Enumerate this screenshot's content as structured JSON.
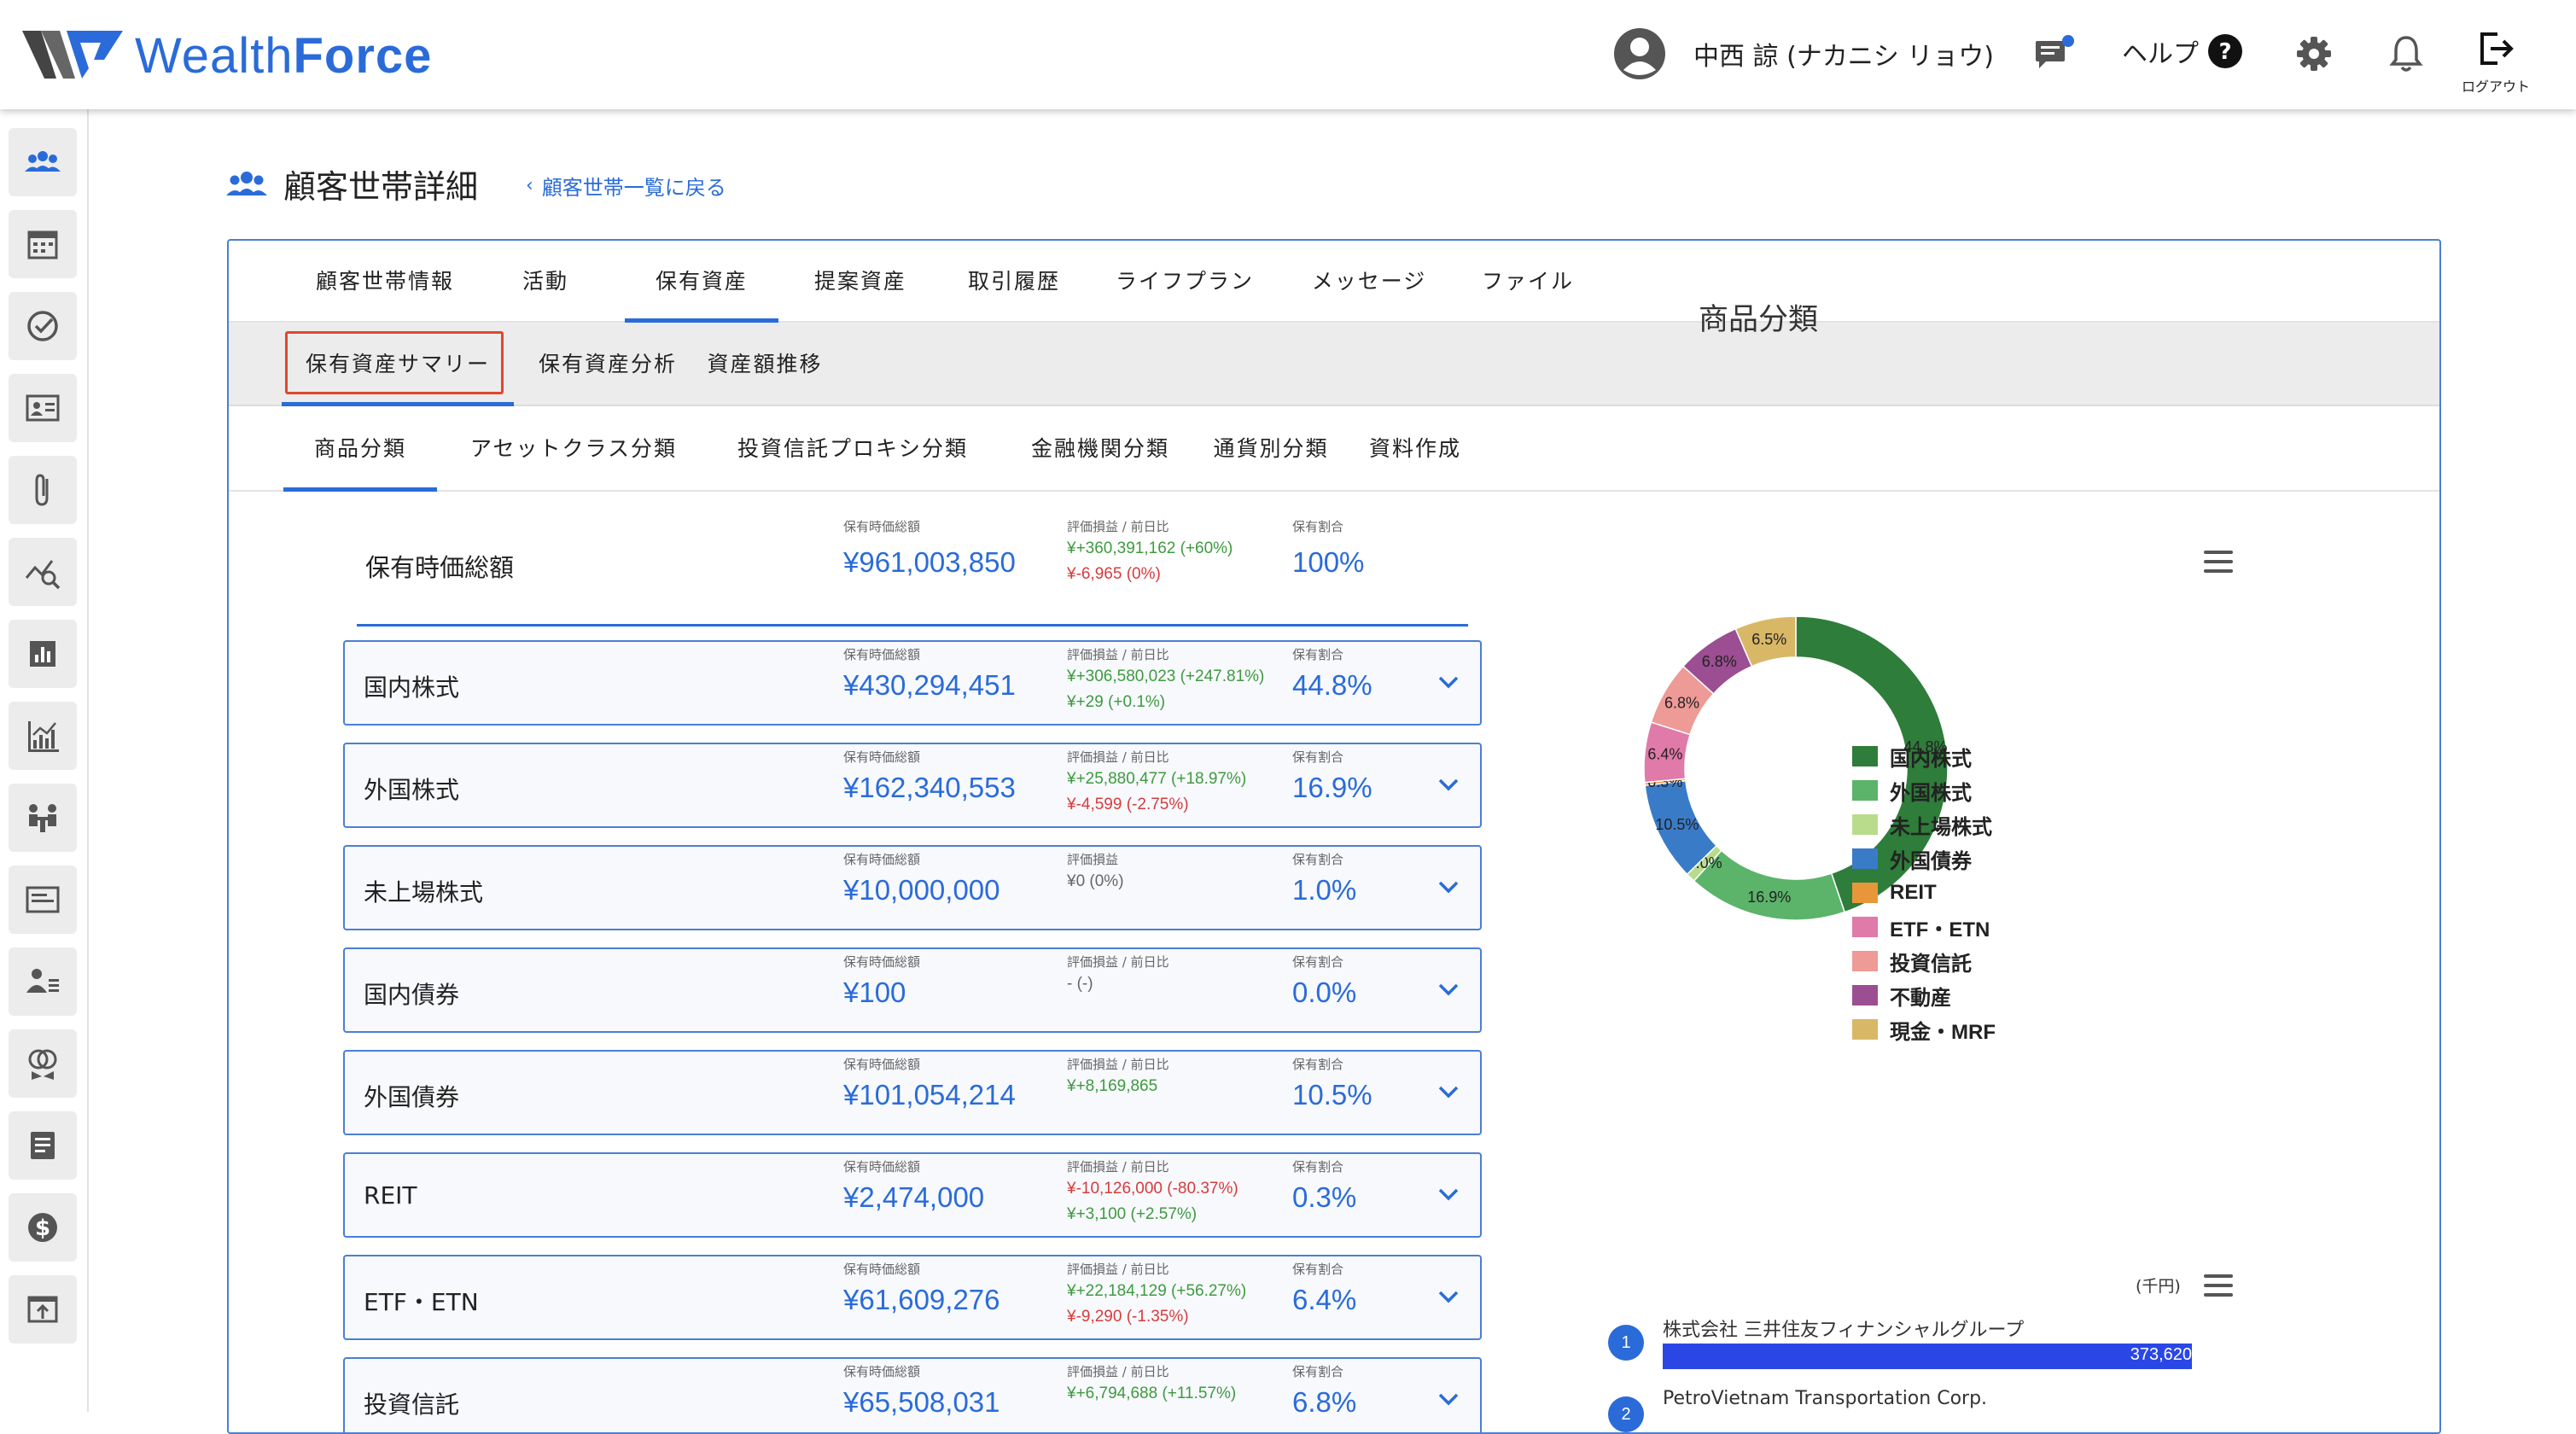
{
  "header": {
    "logo_text": "WealthForce",
    "user_name": "中西 諒 (ナカニシ リョウ)",
    "help_label": "ヘルプ",
    "logout_label": "ログアウト",
    "icons": [
      "avatar-icon",
      "chat-icon",
      "help-icon",
      "gear-icon",
      "bell-icon",
      "logout-icon"
    ],
    "accent_color": "#2a6bd9"
  },
  "sidebar": {
    "items": [
      "household-icon",
      "calendar-icon",
      "check-circle-icon",
      "profile-card-icon",
      "paperclip-icon",
      "chart-search-icon",
      "bar-chart-icon",
      "growth-chart-icon",
      "meeting-icon",
      "window-icon",
      "user-list-icon",
      "rings-icon",
      "document-icon",
      "dollar-icon",
      "export-icon"
    ]
  },
  "page": {
    "title": "顧客世帯詳細",
    "back_link": "顧客世帯一覧に戻る"
  },
  "tabs_main": [
    "顧客世帯情報",
    "活動",
    "保有資産",
    "提案資産",
    "取引履歴",
    "ライフプラン",
    "メッセージ",
    "ファイル"
  ],
  "tabs_main_active": "保有資産",
  "tabs_sub": [
    "保有資産サマリー",
    "保有資産分析",
    "資産額推移"
  ],
  "tabs_sub_active": "保有資産サマリー",
  "tabs_third": [
    "商品分類",
    "アセットクラス分類",
    "投資信託プロキシ分類",
    "金融機関分類",
    "通貨別分類",
    "資料作成"
  ],
  "tabs_third_active": "商品分類",
  "summary": {
    "title": "保有時価総額",
    "value_label": "保有時価総額",
    "value": "¥961,003,850",
    "pl_label": "評価損益 / 前日比",
    "pl_1": "¥+360,391,162 (+60%)",
    "pl_2": "¥-6,965 (0%)",
    "ratio_label": "保有割合",
    "ratio": "100%"
  },
  "rows": [
    {
      "name": "国内株式",
      "value_label": "保有時価総額",
      "value": "¥430,294,451",
      "pl_label": "評価損益 / 前日比",
      "pl_1": "¥+306,580,023 (+247.81%)",
      "pl_1_color": "green",
      "pl_2": "¥+29 (+0.1%)",
      "pl_2_color": "green",
      "ratio_label": "保有割合",
      "ratio": "44.8%"
    },
    {
      "name": "外国株式",
      "value_label": "保有時価総額",
      "value": "¥162,340,553",
      "pl_label": "評価損益 / 前日比",
      "pl_1": "¥+25,880,477 (+18.97%)",
      "pl_1_color": "green",
      "pl_2": "¥-4,599 (-2.75%)",
      "pl_2_color": "red",
      "ratio_label": "保有割合",
      "ratio": "16.9%"
    },
    {
      "name": "未上場株式",
      "value_label": "保有時価総額",
      "value": "¥10,000,000",
      "pl_label": "評価損益",
      "pl_1": "¥0 (0%)",
      "pl_1_color": "gray",
      "pl_2": "",
      "pl_2_color": "gray",
      "ratio_label": "保有割合",
      "ratio": "1.0%"
    },
    {
      "name": "国内債券",
      "value_label": "保有時価総額",
      "value": "¥100",
      "pl_label": "評価損益 / 前日比",
      "pl_1": "- (-)",
      "pl_1_color": "gray",
      "pl_2": "",
      "pl_2_color": "gray",
      "ratio_label": "保有割合",
      "ratio": "0.0%"
    },
    {
      "name": "外国債券",
      "value_label": "保有時価総額",
      "value": "¥101,054,214",
      "pl_label": "評価損益 / 前日比",
      "pl_1": "¥+8,169,865",
      "pl_1_color": "green",
      "pl_2": "",
      "pl_2_color": "gray",
      "ratio_label": "保有割合",
      "ratio": "10.5%"
    },
    {
      "name": "REIT",
      "value_label": "保有時価総額",
      "value": "¥2,474,000",
      "pl_label": "評価損益 / 前日比",
      "pl_1": "¥-10,126,000 (-80.37%)",
      "pl_1_color": "red",
      "pl_2": "¥+3,100 (+2.57%)",
      "pl_2_color": "green",
      "ratio_label": "保有割合",
      "ratio": "0.3%"
    },
    {
      "name": "ETF・ETN",
      "value_label": "保有時価総額",
      "value": "¥61,609,276",
      "pl_label": "評価損益 / 前日比",
      "pl_1": "¥+22,184,129 (+56.27%)",
      "pl_1_color": "green",
      "pl_2": "¥-9,290 (-1.35%)",
      "pl_2_color": "red",
      "ratio_label": "保有割合",
      "ratio": "6.4%"
    },
    {
      "name": "投資信託",
      "value_label": "保有時価総額",
      "value": "¥65,508,031",
      "pl_label": "評価損益 / 前日比",
      "pl_1": "¥+6,794,688 (+11.57%)",
      "pl_1_color": "green",
      "pl_2": "",
      "pl_2_color": "gray",
      "ratio_label": "保有割合",
      "ratio": "6.8%"
    }
  ],
  "chart_data": [
    {
      "type": "pie",
      "title": "商品分類",
      "categories": [
        "国内株式",
        "外国株式",
        "未上場株式",
        "外国債券",
        "REIT",
        "ETF・ETN",
        "投資信託",
        "不動産",
        "現金・MRF"
      ],
      "values": [
        44.8,
        16.9,
        1.0,
        10.5,
        0.3,
        6.4,
        6.8,
        6.8,
        6.5
      ],
      "labels": [
        "44.8%",
        "16.9%",
        "1.0%",
        "10.5%",
        "0.3%",
        "6.4%",
        "6.8%",
        "6.8%",
        "6.5%"
      ],
      "colors": [
        "#2e7d3a",
        "#5cb36a",
        "#b8dc8c",
        "#3a7bc8",
        "#e8963a",
        "#e07aa8",
        "#ee9a96",
        "#9b4e92",
        "#d8b866"
      ],
      "legend": "center"
    },
    {
      "type": "bar",
      "unit": "(千円)",
      "categories": [
        "株式会社 三井住友フィナンシャルグループ",
        "PetroVietnam Transportation Corp."
      ],
      "values": [
        373620,
        null
      ],
      "value_labels": [
        "373,620",
        ""
      ],
      "xlim": [
        0,
        373620
      ]
    }
  ]
}
